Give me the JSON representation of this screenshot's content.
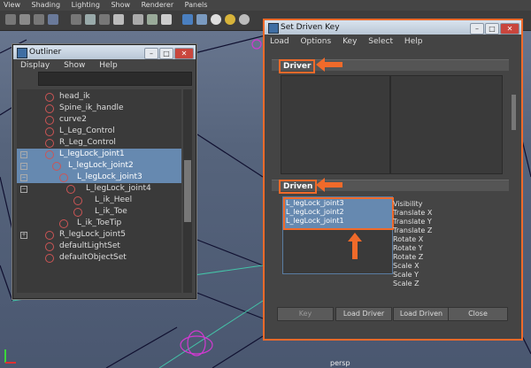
{
  "menubar": [
    "View",
    "Shading",
    "Lighting",
    "Show",
    "Renderer",
    "Panels"
  ],
  "viewport": {
    "camera_label": "persp"
  },
  "outliner": {
    "title": "Outliner",
    "menu": [
      "Display",
      "Show",
      "Help"
    ],
    "items": [
      {
        "label": "head_ik",
        "indent": 0,
        "selected": false,
        "expander": ""
      },
      {
        "label": "Spine_ik_handle",
        "indent": 0,
        "selected": false,
        "expander": ""
      },
      {
        "label": "curve2",
        "indent": 0,
        "selected": false,
        "expander": ""
      },
      {
        "label": "L_Leg_Control",
        "indent": 0,
        "selected": false,
        "expander": ""
      },
      {
        "label": "R_Leg_Control",
        "indent": 0,
        "selected": false,
        "expander": ""
      },
      {
        "label": "L_legLock_joint1",
        "indent": 0,
        "selected": true,
        "expander": "−"
      },
      {
        "label": "L_legLock_joint2",
        "indent": 1,
        "selected": true,
        "expander": "−"
      },
      {
        "label": "L_legLock_joint3",
        "indent": 2,
        "selected": true,
        "expander": "−"
      },
      {
        "label": "L_legLock_joint4",
        "indent": 3,
        "selected": false,
        "expander": "−"
      },
      {
        "label": "L_ik_Heel",
        "indent": 4,
        "selected": false,
        "expander": ""
      },
      {
        "label": "L_ik_Toe",
        "indent": 4,
        "selected": false,
        "expander": ""
      },
      {
        "label": "L_ik_ToeTip",
        "indent": 2,
        "selected": false,
        "expander": ""
      },
      {
        "label": "R_legLock_joint5",
        "indent": 0,
        "selected": false,
        "expander": "+"
      },
      {
        "label": "defaultLightSet",
        "indent": 0,
        "selected": false,
        "expander": ""
      },
      {
        "label": "defaultObjectSet",
        "indent": 0,
        "selected": false,
        "expander": ""
      }
    ]
  },
  "sdk": {
    "title": "Set Driven Key",
    "menu": [
      "Load",
      "Options",
      "Key",
      "Select",
      "Help"
    ],
    "driver_label": "Driver",
    "driven_label": "Driven",
    "driven_objects": [
      "L_legLock_joint3",
      "L_legLock_joint2",
      "L_legLock_joint1"
    ],
    "driven_attributes": [
      "Visibility",
      "Translate X",
      "Translate Y",
      "Translate Z",
      "Rotate X",
      "Rotate Y",
      "Rotate Z",
      "Scale X",
      "Scale Y",
      "Scale Z"
    ],
    "buttons": {
      "key": "Key",
      "load_driver": "Load Driver",
      "load_driven": "Load Driven",
      "close": "Close"
    }
  },
  "colors": {
    "highlight": "#f06a2a",
    "selection": "#6689b0"
  }
}
